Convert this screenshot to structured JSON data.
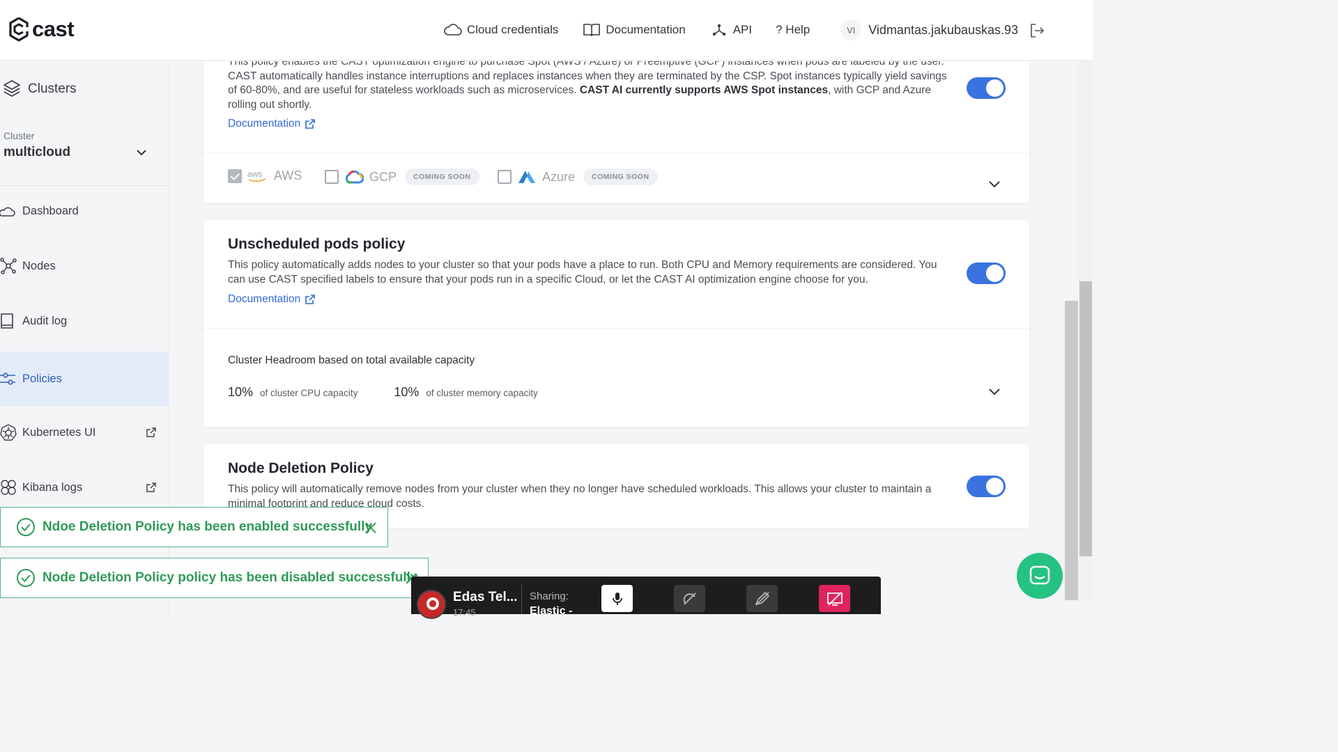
{
  "header": {
    "logo_text": "cast",
    "nav": [
      {
        "label": "Cloud credentials",
        "icon": "cloud-icon"
      },
      {
        "label": "Documentation",
        "icon": "book-icon"
      },
      {
        "label": "API",
        "icon": "api-icon"
      },
      {
        "label": "? Help",
        "icon": "help-icon"
      }
    ],
    "user": {
      "initials": "VI",
      "name": "Vidmantas.jakubauskas.93"
    }
  },
  "sidebar": {
    "section_title": "Clusters",
    "cluster_label": "Cluster",
    "cluster_name": "multicloud",
    "items": [
      {
        "label": "Dashboard",
        "icon": "cloud-icon"
      },
      {
        "label": "Nodes",
        "icon": "nodes-icon"
      },
      {
        "label": "Audit log",
        "icon": "book-icon"
      },
      {
        "label": "Policies",
        "icon": "sliders-icon",
        "active": true
      },
      {
        "label": "Kubernetes UI",
        "icon": "kubernetes-icon",
        "external": true
      },
      {
        "label": "Kibana logs",
        "icon": "kibana-icon",
        "external": true
      }
    ]
  },
  "spot_policy": {
    "desc_line0": "This policy enables the CAST optimization engine to purchase Spot (AWS / Azure) or Preemptive (GCP) instances when pods are labeled by the",
    "desc_main": "user. CAST automatically handles instance interruptions and replaces instances when they are terminated by the CSP. Spot instances typically yield savings of 60-80%, and are useful for stateless workloads such as microservices. ",
    "desc_bold": "CAST AI currently supports AWS Spot instances",
    "desc_tail": ", with GCP and Azure rolling out shortly.",
    "doc_link": "Documentation",
    "enabled": true,
    "providers": [
      {
        "name": "AWS",
        "logo": "aws",
        "checked": true,
        "badge": ""
      },
      {
        "name": "GCP",
        "logo": "gcp",
        "checked": false,
        "badge": "COMING SOON"
      },
      {
        "name": "Azure",
        "logo": "azure",
        "checked": false,
        "badge": "COMING SOON"
      }
    ]
  },
  "unscheduled_policy": {
    "title": "Unscheduled pods policy",
    "desc": "This policy automatically adds nodes to your cluster so that your pods have a place to run. Both CPU and Memory requirements are considered. You can use CAST specified labels to ensure that your pods run in a specific Cloud, or let the CAST AI optimization engine choose for you.",
    "doc_link": "Documentation",
    "enabled": true,
    "headroom_title": "Cluster Headroom based on total available capacity",
    "cpu_pct": "10%",
    "cpu_label": "of cluster CPU capacity",
    "mem_pct": "10%",
    "mem_label": "of cluster memory capacity"
  },
  "node_deletion_policy": {
    "title": "Node Deletion Policy",
    "desc": "This policy will automatically remove nodes from your cluster when they no longer have scheduled workloads. This allows your cluster to maintain a minimal footprint and reduce cloud costs.",
    "enabled": true
  },
  "toasts": [
    {
      "message": "Ndoe Deletion Policy has been enabled successfully"
    },
    {
      "message": "Node Deletion Policy policy has been disabled successfully"
    }
  ],
  "sharebar": {
    "name": "Edas Tel...",
    "time": "17:45",
    "sharing_label": "Sharing:",
    "sharing_target": "Elastic -"
  },
  "colors": {
    "accent": "#3a73e0",
    "link": "#2f6bd8",
    "success": "#2f9a57",
    "chat": "#26c281"
  }
}
